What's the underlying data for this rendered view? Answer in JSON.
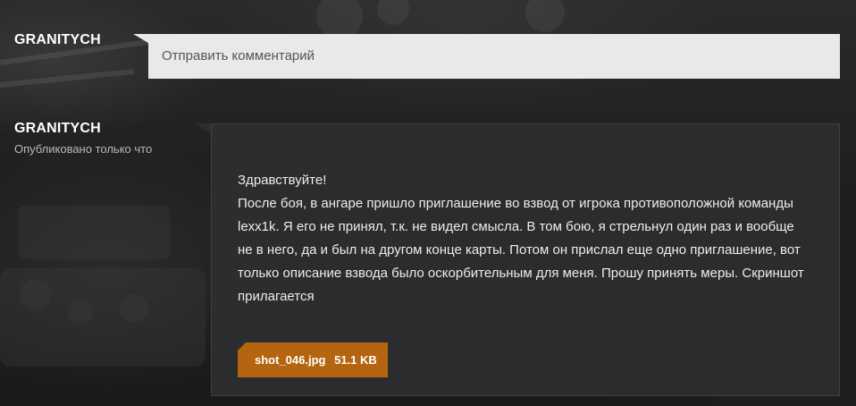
{
  "comment_form": {
    "author": "GRANITYCH",
    "placeholder": "Отправить комментарий"
  },
  "comment": {
    "author": "GRANITYCH",
    "published": "Опубликовано только что",
    "body": "Здравствуйте!\nПосле боя, в ангаре пришло приглашение во взвод от игрока противоположной команды lexx1k. Я его не принял, т.к. не видел смысла. В том бою, я стрельнул один раз и вообще не в него, да и был на другом конце карты. Потом он прислал еще одно приглашение, вот только описание взвода было оскорбительным для меня. Прошу принять меры. Скриншот прилагается",
    "attachment": {
      "filename": "shot_046.jpg",
      "size": "51.1 KB"
    }
  },
  "colors": {
    "attachment_bg": "#b5650f",
    "input_bg": "#e9e9e9",
    "bubble_bg": "#2c2e30"
  }
}
